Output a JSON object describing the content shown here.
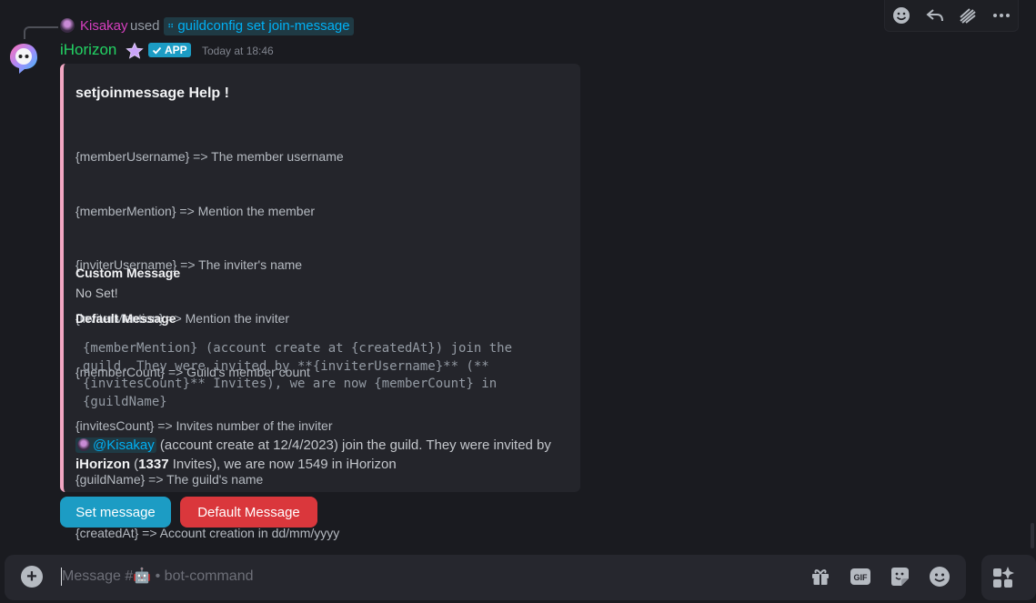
{
  "toolbar": {
    "icons": [
      "emoji-add-icon",
      "reply-icon",
      "apps-icon",
      "more-icon"
    ]
  },
  "reply": {
    "user": "Kisakay",
    "used": "used",
    "command": "guildconfig set join-message"
  },
  "message": {
    "author": "iHorizon",
    "badge": "APP",
    "timestamp": "Today at 18:46"
  },
  "embed": {
    "accent_color": "#f2a7c3",
    "title": "setjoinmessage Help !",
    "lines": [
      "{memberUsername} => The member username",
      "{memberMention} => Mention the member",
      "{inviterUsername} => The inviter's name",
      "{inviterMention} => Mention the inviter",
      "{memberCount} => Guild's member count",
      "{invitesCount} => Invites number of the inviter",
      "{guildName} => The guild's name",
      "{createdAt} => Account creation in dd/mm/yyyy"
    ],
    "custom_label": "Custom Message",
    "custom_value": "No Set!",
    "default_label": "Default Message",
    "default_code": "{memberMention} (account create at {createdAt}) join the guild. They were invited by **{inviterUsername}** (**{invitesCount}** Invites), we are now {memberCount} in {guildName}",
    "preview": {
      "mention": "@Kisakay",
      "text1": " (account create at 12/4/2023) join the guild. They were invited by ",
      "bold1": "iHorizon",
      "text2": " (",
      "bold2": "1337",
      "text3": " Invites), we are now 1549 in iHorizon"
    }
  },
  "buttons": {
    "set": "Set message",
    "default": "Default Message"
  },
  "composer": {
    "placeholder": "Message #🤖 • bot-command"
  },
  "colors": {
    "primary_button": "#1c9cc4",
    "danger_button": "#da373c",
    "author": "#23d364",
    "reply_user": "#d63fbf",
    "mention": "#00b0f4"
  }
}
